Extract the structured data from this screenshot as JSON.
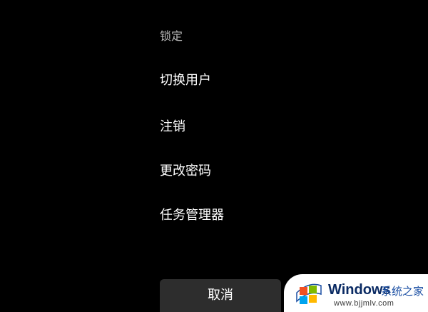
{
  "menu": {
    "items": [
      {
        "label": "锁定",
        "name": "menu-item-lock"
      },
      {
        "label": "切换用户",
        "name": "menu-item-switch-user"
      },
      {
        "label": "注销",
        "name": "menu-item-sign-out"
      },
      {
        "label": "更改密码",
        "name": "menu-item-change-password"
      },
      {
        "label": "任务管理器",
        "name": "menu-item-task-manager"
      }
    ]
  },
  "footer": {
    "cancel_label": "取消"
  },
  "watermark": {
    "brand": "Windows",
    "brand_cn": "系统之家",
    "url": "www.bjjmlv.com",
    "logo_colors": [
      "#f25022",
      "#7fba00",
      "#00a4ef",
      "#ffb900"
    ]
  }
}
